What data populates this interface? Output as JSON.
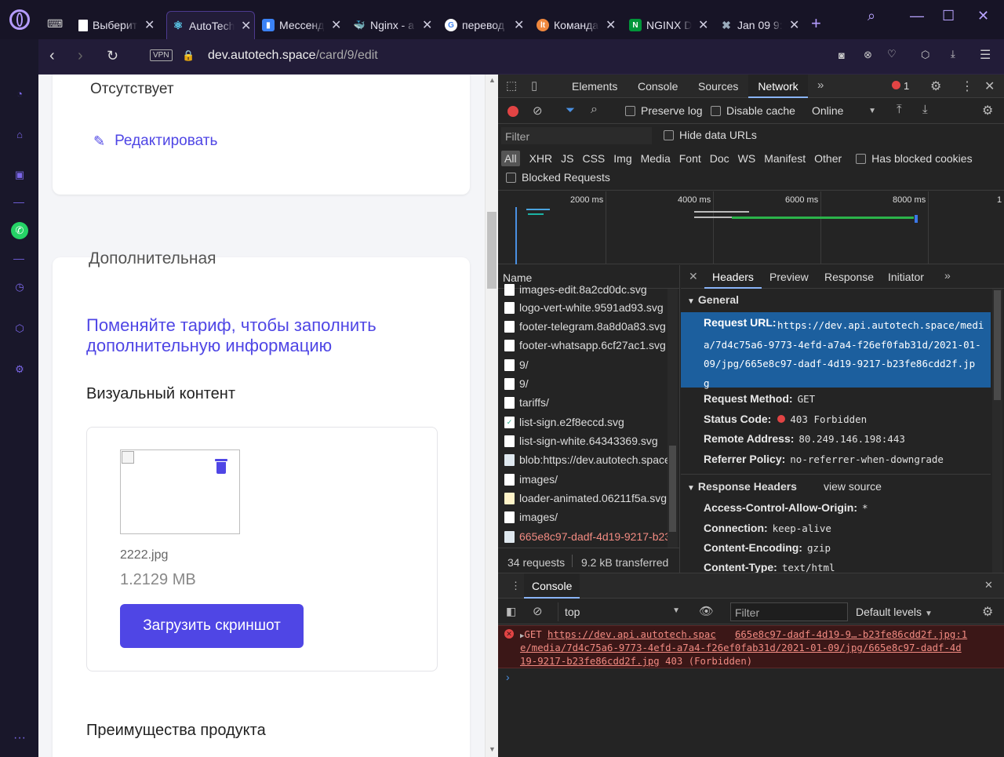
{
  "tabs": [
    {
      "label": "Выберите"
    },
    {
      "label": "AutoTech"
    },
    {
      "label": "Мессендж"
    },
    {
      "label": "Nginx - а"
    },
    {
      "label": "перевод"
    },
    {
      "label": "Команда"
    },
    {
      "label": "NGINX D"
    },
    {
      "label": "Jan 09 9:"
    }
  ],
  "address": {
    "vpn": "VPN",
    "url_domain": "dev.autotech.space",
    "url_path": "/card/9/edit"
  },
  "page": {
    "absent": "Отсутствует",
    "edit_label": "Редактировать",
    "section_title": "Дополнительная",
    "tariff_link": "Поменяйте тариф, чтобы заполнить дополнительную информацию",
    "visual_heading": "Визуальный контент",
    "file_name": "2222.jpg",
    "file_size": "1.2129 MB",
    "upload_button": "Загрузить скриншот",
    "advantages_heading": "Преимущества продукта"
  },
  "devtools": {
    "tabs": [
      "Elements",
      "Console",
      "Sources",
      "Network"
    ],
    "active_tab": "Network",
    "error_count": "1",
    "preserve_log": "Preserve log",
    "disable_cache": "Disable cache",
    "throttle": "Online",
    "filter_placeholder": "Filter",
    "hide_data_urls": "Hide data URLs",
    "types": [
      "All",
      "XHR",
      "JS",
      "CSS",
      "Img",
      "Media",
      "Font",
      "Doc",
      "WS",
      "Manifest",
      "Other"
    ],
    "has_blocked_cookies": "Has blocked cookies",
    "blocked_requests": "Blocked Requests",
    "timeline_ticks": [
      "2000 ms",
      "4000 ms",
      "6000 ms",
      "8000 ms",
      "1"
    ],
    "name_header": "Name",
    "requests": [
      "images-edit.8a2cd0dc.svg",
      "logo-vert-white.9591ad93.svg",
      "footer-telegram.8a8d0a83.svg",
      "footer-whatsapp.6cf27ac1.svg",
      "9/",
      "9/",
      "tariffs/",
      "list-sign.e2f8eccd.svg",
      "list-sign-white.64343369.svg",
      "blob:https://dev.autotech.space",
      "images/",
      "loader-animated.06211f5a.svg",
      "images/",
      "665e8c97-dadf-4d19-9217-b23"
    ],
    "summary_requests": "34 requests",
    "summary_transferred": "9.2 kB transferred",
    "detail_tabs": [
      "Headers",
      "Preview",
      "Response",
      "Initiator"
    ],
    "general_label": "General",
    "request_url_label": "Request URL:",
    "request_url_lines": [
      "https://dev.api.autotech.space/medi",
      "a/7d4c75a6-9773-4efd-a7a4-f26ef0fab31d/2021-01-",
      "09/jpg/665e8c97-dadf-4d19-9217-b23fe86cdd2f.jp",
      "g"
    ],
    "request_method_label": "Request Method:",
    "request_method": "GET",
    "status_code_label": "Status Code:",
    "status_code": "403 Forbidden",
    "remote_address_label": "Remote Address:",
    "remote_address": "80.249.146.198:443",
    "referrer_label": "Referrer Policy:",
    "referrer": "no-referrer-when-downgrade",
    "response_headers_label": "Response Headers",
    "view_source": "view source",
    "acao_label": "Access-Control-Allow-Origin:",
    "acao": "*",
    "connection_label": "Connection:",
    "connection": "keep-alive",
    "encoding_label": "Content-Encoding:",
    "encoding": "gzip",
    "ctype_label": "Content-Type:",
    "ctype": "text/html",
    "console_label": "Console",
    "context": "top",
    "console_filter": "Filter",
    "levels": "Default levels",
    "error_get": "GET",
    "error_url_a": "https://dev.api.autotech.spac",
    "error_src": "665e8c97-dadf-4d19-9…-b23fe86cdd2f.jpg:1",
    "error_line2": "e/media/7d4c75a6-9773-4efd-a7a4-f26ef0fab31d/2021-01-09/jpg/665e8c97-dadf-4d",
    "error_line3": "19-9217-b23fe86cdd2f.jpg",
    "error_status": "403 (Forbidden)"
  },
  "colors": {
    "accent": "#4f46e5",
    "link": "#4f46e5",
    "devtools_bg": "#242424",
    "selected": "#1c5f9e",
    "error": "#e24444"
  }
}
